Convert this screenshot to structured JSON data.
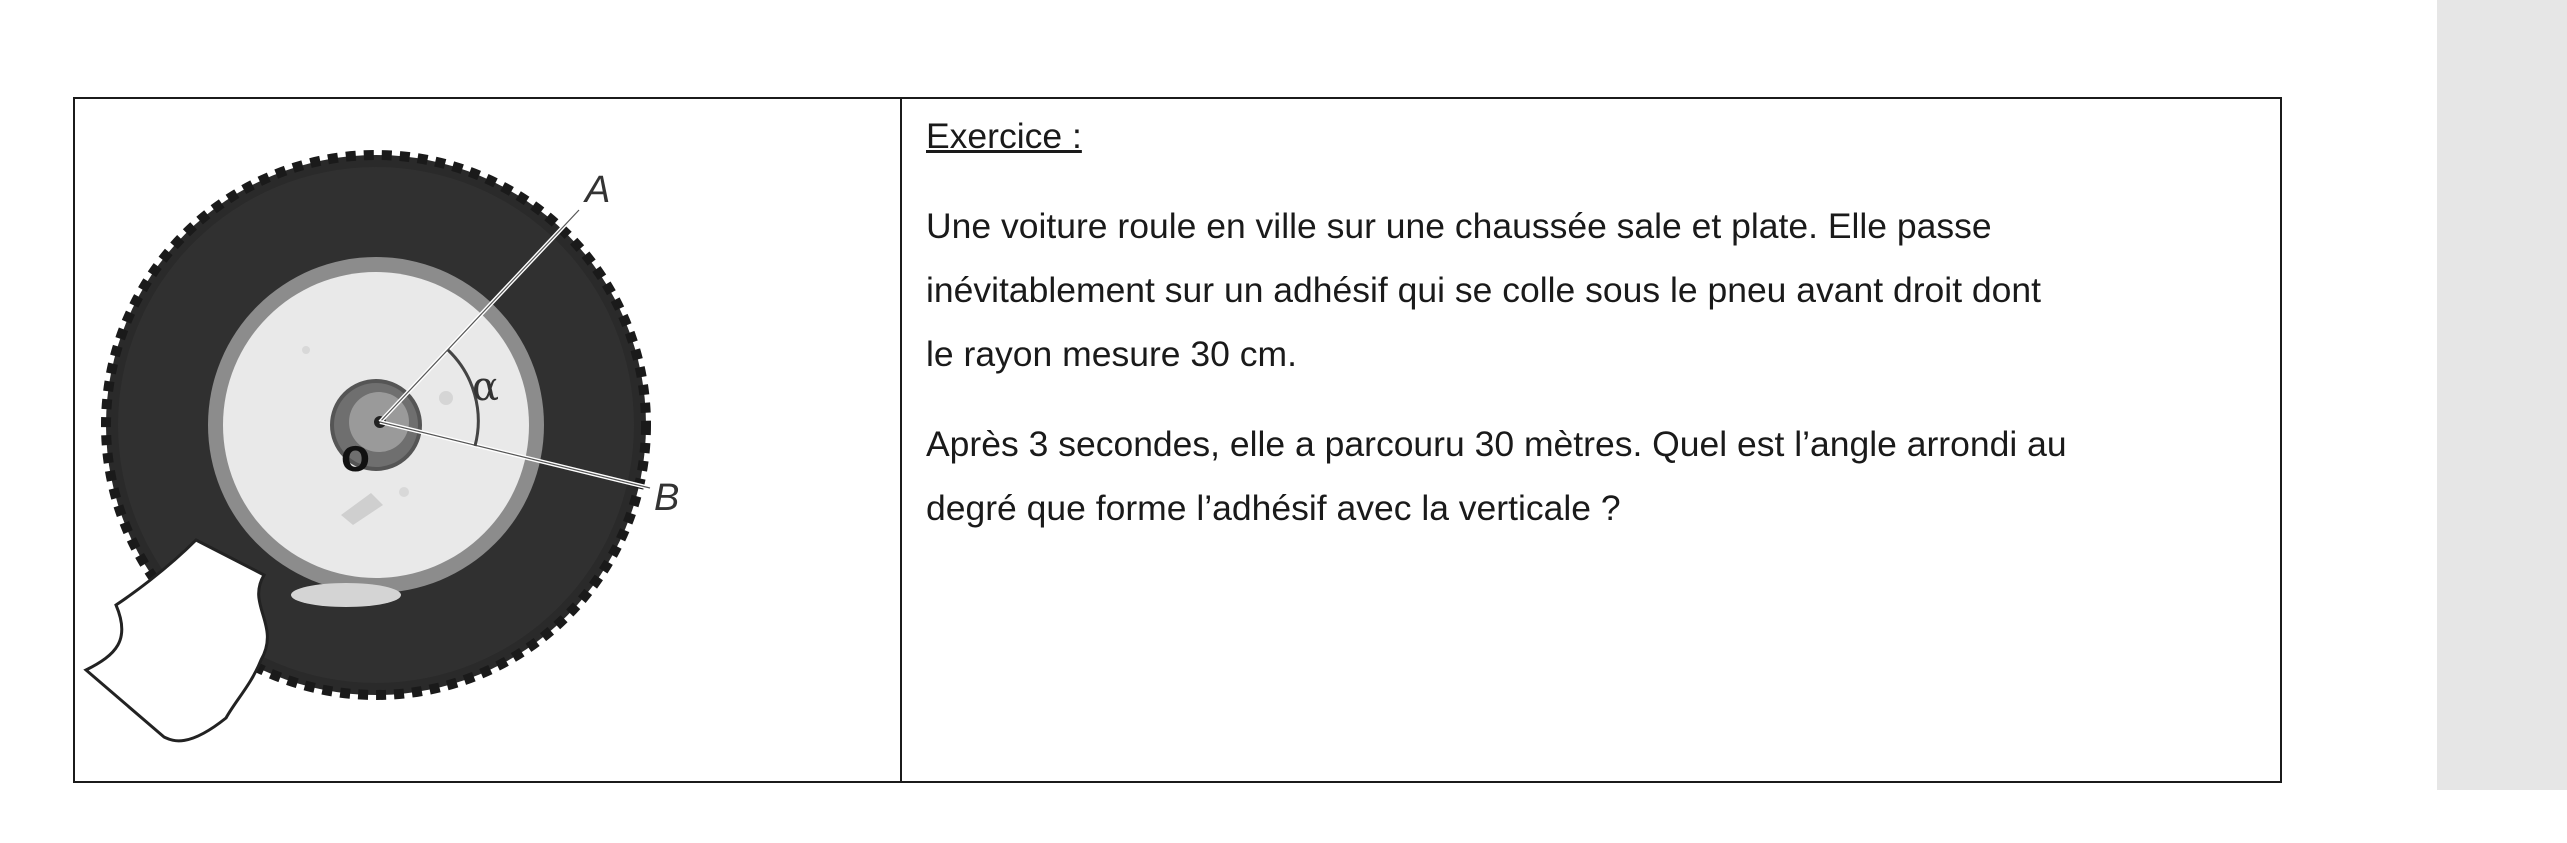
{
  "exercise": {
    "heading": "Exercice :",
    "paragraph1_line1": "Une voiture roule en ville sur une chaussée sale et plate. Elle passe",
    "paragraph1_line2": "inévitablement sur un adhésif qui se colle sous le pneu avant droit dont",
    "paragraph1_line3": "le rayon mesure 30 cm.",
    "paragraph2_line1": "Après 3 secondes, elle a parcouru 30 mètres. Quel est l’angle arrondi au",
    "paragraph2_line2": "degré que forme l’adhésif avec la verticale ?"
  },
  "figure": {
    "label_a": "A",
    "label_b": "B",
    "label_alpha": "α",
    "label_center": "O"
  }
}
